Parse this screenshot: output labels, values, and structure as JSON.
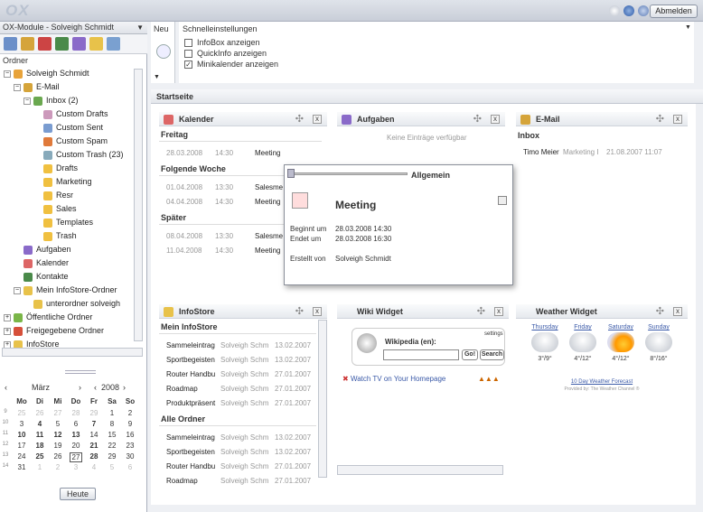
{
  "topbar": {
    "logo": "OX",
    "logout": "Abmelden"
  },
  "left": {
    "module_title": "OX-Module - Solveigh Schmidt",
    "folders_label": "Ordner",
    "tree": [
      {
        "label": "Solveigh Schmidt",
        "icon": "user-icon",
        "indent": 0,
        "pm": "−"
      },
      {
        "label": "E-Mail",
        "icon": "mail-icon",
        "indent": 1,
        "pm": "−"
      },
      {
        "label": "Inbox (2)",
        "icon": "inbox-icon",
        "indent": 2,
        "pm": "−"
      },
      {
        "label": "Custom Drafts",
        "icon": "drafts-icon",
        "indent": 3
      },
      {
        "label": "Custom Sent",
        "icon": "sent-icon",
        "indent": 3
      },
      {
        "label": "Custom Spam",
        "icon": "spam-icon",
        "indent": 3
      },
      {
        "label": "Custom Trash (23)",
        "icon": "trash-icon",
        "indent": 3
      },
      {
        "label": "Drafts",
        "icon": "folder-icon",
        "indent": 3
      },
      {
        "label": "Marketing",
        "icon": "folder-icon",
        "indent": 3
      },
      {
        "label": "Resr",
        "icon": "folder-icon",
        "indent": 3
      },
      {
        "label": "Sales",
        "icon": "folder-icon",
        "indent": 3
      },
      {
        "label": "Templates",
        "icon": "folder-icon",
        "indent": 3
      },
      {
        "label": "Trash",
        "icon": "folder-icon",
        "indent": 3
      },
      {
        "label": "Aufgaben",
        "icon": "tasks-icon",
        "indent": 1
      },
      {
        "label": "Kalender",
        "icon": "calendar-icon",
        "indent": 1
      },
      {
        "label": "Kontakte",
        "icon": "contacts-icon",
        "indent": 1
      },
      {
        "label": "Mein InfoStore-Ordner",
        "icon": "infostore-icon",
        "indent": 1,
        "pm": "−"
      },
      {
        "label": "unterordner solveigh",
        "icon": "infostore-icon",
        "indent": 2
      },
      {
        "label": "Öffentliche Ordner",
        "icon": "public-folder-icon",
        "indent": 0,
        "pm": "+"
      },
      {
        "label": "Freigegebene Ordner",
        "icon": "shared-folder-icon",
        "indent": 0,
        "pm": "+"
      },
      {
        "label": "InfoStore",
        "icon": "infostore-icon",
        "indent": 0,
        "pm": "+"
      }
    ],
    "calendar": {
      "month": "März",
      "year": "2008",
      "weekdays": [
        "Mo",
        "Di",
        "Mi",
        "Do",
        "Fr",
        "Sa",
        "So"
      ],
      "weeks": [
        {
          "kw": "9",
          "days": [
            "25",
            "26",
            "27",
            "28",
            "29",
            "1",
            "2"
          ],
          "other": [
            0,
            1,
            2,
            3,
            4
          ]
        },
        {
          "kw": "10",
          "days": [
            "3",
            "4",
            "5",
            "6",
            "7",
            "8",
            "9"
          ],
          "bold": [
            1,
            4
          ]
        },
        {
          "kw": "11",
          "days": [
            "10",
            "11",
            "12",
            "13",
            "14",
            "15",
            "16"
          ],
          "bold": [
            0,
            1,
            2,
            3
          ]
        },
        {
          "kw": "12",
          "days": [
            "17",
            "18",
            "19",
            "20",
            "21",
            "22",
            "23"
          ],
          "bold": [
            1,
            4
          ]
        },
        {
          "kw": "13",
          "days": [
            "24",
            "25",
            "26",
            "27",
            "28",
            "29",
            "30"
          ],
          "bold": [
            1,
            4
          ],
          "today": 3
        },
        {
          "kw": "14",
          "days": [
            "31",
            "1",
            "2",
            "3",
            "4",
            "5",
            "6"
          ],
          "other": [
            1,
            2,
            3,
            4,
            5,
            6
          ]
        }
      ],
      "today_btn": "Heute"
    }
  },
  "toolbar": {
    "new_label": "Neu",
    "quick_label": "Schnelleinstellungen",
    "options": [
      {
        "label": "InfoBox anzeigen",
        "checked": false
      },
      {
        "label": "QuickInfo anzeigen",
        "checked": false
      },
      {
        "label": "Minikalender anzeigen",
        "checked": true
      }
    ]
  },
  "startseite": "Startseite",
  "kalender": {
    "title": "Kalender",
    "groups": [
      {
        "label": "Freitag",
        "items": [
          [
            "28.03.2008",
            "14:30",
            "Meeting"
          ]
        ]
      },
      {
        "label": "Folgende Woche",
        "items": [
          [
            "01.04.2008",
            "13:30",
            "Salesme"
          ],
          [
            "04.04.2008",
            "14:30",
            "Meeting"
          ]
        ]
      },
      {
        "label": "Später",
        "items": [
          [
            "08.04.2008",
            "13:30",
            "Salesme"
          ],
          [
            "11.04.2008",
            "14:30",
            "Meeting"
          ]
        ]
      }
    ]
  },
  "aufgaben": {
    "title": "Aufgaben",
    "empty": "Keine Einträge verfügbar"
  },
  "email": {
    "title": "E-Mail",
    "folder": "Inbox",
    "row": [
      "Timo Meier",
      "Marketing I",
      "21.08.2007 11:07"
    ]
  },
  "popup": {
    "tab": "Allgemein",
    "title": "Meeting",
    "begin_label": "Beginnt um",
    "begin": "28.03.2008 14:30",
    "end_label": "Endet um",
    "end": "28.03.2008 16:30",
    "creator_label": "Erstellt von",
    "creator": "Solveigh Schmidt"
  },
  "infostore": {
    "title": "InfoStore",
    "groups": [
      {
        "label": "Mein InfoStore",
        "items": [
          [
            "Sammeleintrag",
            "Solveigh Schm",
            "13.02.2007"
          ],
          [
            "Sportbegeisten",
            "Solveigh Schm",
            "13.02.2007"
          ],
          [
            "Router Handbu",
            "Solveigh Schm",
            "27.01.2007"
          ],
          [
            "Roadmap",
            "Solveigh Schm",
            "27.01.2007"
          ],
          [
            "Produktpräsent",
            "Solveigh Schm",
            "27.01.2007"
          ]
        ]
      },
      {
        "label": "Alle Ordner",
        "items": [
          [
            "Sammeleintrag",
            "Solveigh Schm",
            "13.02.2007"
          ],
          [
            "Sportbegeisten",
            "Solveigh Schm",
            "13.02.2007"
          ],
          [
            "Router Handbu",
            "Solveigh Schm",
            "27.01.2007"
          ],
          [
            "Roadmap",
            "Solveigh Schm",
            "27.01.2007"
          ]
        ]
      }
    ]
  },
  "wiki": {
    "title": "Wiki Widget",
    "settings": "settings",
    "wikipedia": "Wikipedia (en):",
    "go": "Go!",
    "search": "Search",
    "tv": "Watch TV on Your Homepage"
  },
  "weather": {
    "title": "Weather Widget",
    "days": [
      {
        "day": "Thursday",
        "temp": "3°/9°",
        "icon": "rain-cloud-icon"
      },
      {
        "day": "Friday",
        "temp": "4°/12°",
        "icon": "rain-cloud-icon"
      },
      {
        "day": "Saturday",
        "temp": "4°/12°",
        "icon": "sun-cloud-icon"
      },
      {
        "day": "Sunday",
        "temp": "8°/16°",
        "icon": "rain-cloud-icon"
      }
    ],
    "forecast": "10 Day Weather Forecast",
    "provided": "Provided by: The Weather Channel ®"
  }
}
